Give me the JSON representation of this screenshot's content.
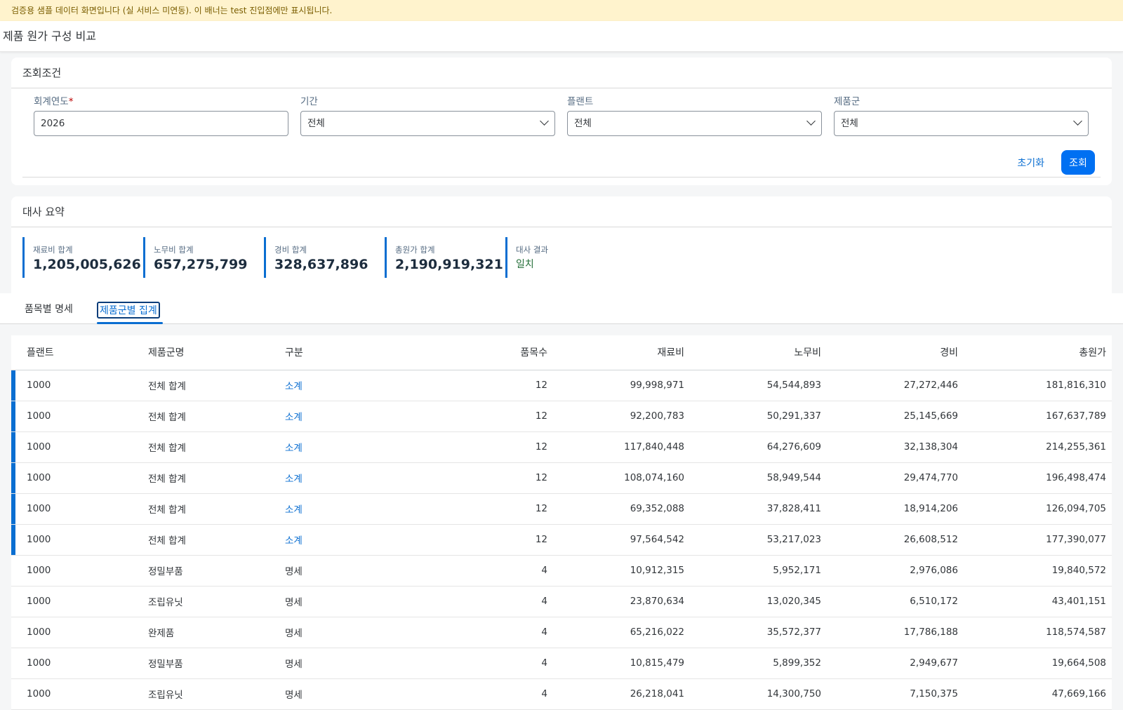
{
  "banner": {
    "text": "검증용 샘플 데이터 화면입니다 (실 서비스 미연동). 이 배너는 test 진입점에만 표시됩니다."
  },
  "header": {
    "title": "제품 원가 구성 비교"
  },
  "filters": {
    "title": "조회조건",
    "fiscal_year": {
      "label": "회계연도",
      "required_mark": "*",
      "value": "2026"
    },
    "period": {
      "label": "기간",
      "value": "전체"
    },
    "plant": {
      "label": "플랜트",
      "value": "전체"
    },
    "product_group": {
      "label": "제품군",
      "value": "전체"
    },
    "reset_label": "초기화",
    "search_label": "조회"
  },
  "summary": {
    "title": "대사 요약",
    "material": {
      "label": "재료비 합계",
      "value": "1,205,005,626"
    },
    "labor": {
      "label": "노무비 합계",
      "value": "657,275,799"
    },
    "overhead": {
      "label": "경비 합계",
      "value": "328,637,896"
    },
    "total": {
      "label": "총원가 합계",
      "value": "2,190,919,321"
    },
    "result": {
      "label": "대사 결과",
      "value": "일치"
    }
  },
  "tabs": [
    {
      "label": "품목별 명세"
    },
    {
      "label": "제품군별 집계"
    }
  ],
  "table": {
    "columns": [
      "플랜트",
      "제품군명",
      "구분",
      "품목수",
      "재료비",
      "노무비",
      "경비",
      "총원가"
    ],
    "rows": [
      [
        "1000",
        "전체 합계",
        "소계",
        "12",
        "99,998,971",
        "54,544,893",
        "27,272,446",
        "181,816,310"
      ],
      [
        "1000",
        "전체 합계",
        "소계",
        "12",
        "92,200,783",
        "50,291,337",
        "25,145,669",
        "167,637,789"
      ],
      [
        "1000",
        "전체 합계",
        "소계",
        "12",
        "117,840,448",
        "64,276,609",
        "32,138,304",
        "214,255,361"
      ],
      [
        "1000",
        "전체 합계",
        "소계",
        "12",
        "108,074,160",
        "58,949,544",
        "29,474,770",
        "196,498,474"
      ],
      [
        "1000",
        "전체 합계",
        "소계",
        "12",
        "69,352,088",
        "37,828,411",
        "18,914,206",
        "126,094,705"
      ],
      [
        "1000",
        "전체 합계",
        "소계",
        "12",
        "97,564,542",
        "53,217,023",
        "26,608,512",
        "177,390,077"
      ],
      [
        "1000",
        "정밀부품",
        "명세",
        "4",
        "10,912,315",
        "5,952,171",
        "2,976,086",
        "19,840,572"
      ],
      [
        "1000",
        "조립유닛",
        "명세",
        "4",
        "23,870,634",
        "13,020,345",
        "6,510,172",
        "43,401,151"
      ],
      [
        "1000",
        "완제품",
        "명세",
        "4",
        "65,216,022",
        "35,572,377",
        "17,786,188",
        "118,574,587"
      ],
      [
        "1000",
        "정밀부품",
        "명세",
        "4",
        "10,815,479",
        "5,899,352",
        "2,949,677",
        "19,664,508"
      ],
      [
        "1000",
        "조립유닛",
        "명세",
        "4",
        "26,218,041",
        "14,300,750",
        "7,150,375",
        "47,669,166"
      ]
    ]
  },
  "colors": {
    "accent": "#0a6ed1",
    "primary_button": "#0070f2",
    "banner_bg": "#fff3cd",
    "match_green": "#256f3a"
  }
}
